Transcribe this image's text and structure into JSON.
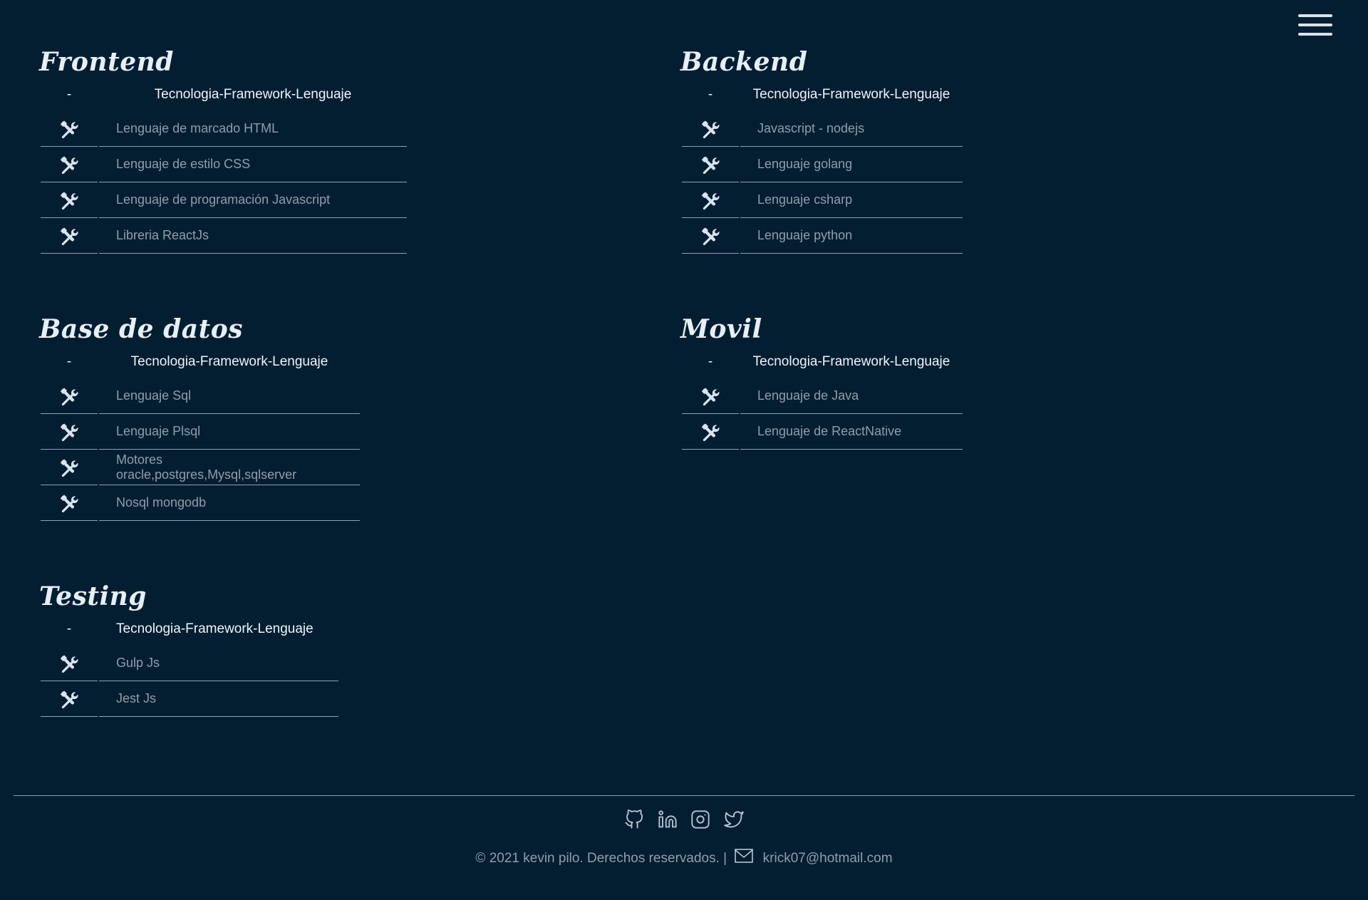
{
  "menu": {
    "icon": "hamburger-menu-icon"
  },
  "sections": {
    "frontend": {
      "title": "Frontend",
      "header_dash": "-",
      "header_label": "Tecnologia-Framework-Lenguaje",
      "items": [
        "Lenguaje de marcado HTML",
        "Lenguaje de estilo CSS",
        "Lenguaje de programación Javascript",
        "Libreria ReactJs"
      ]
    },
    "backend": {
      "title": "Backend",
      "header_dash": "-",
      "header_label": "Tecnologia-Framework-Lenguaje",
      "items": [
        "Javascript - nodejs",
        "Lenguaje golang",
        "Lenguaje csharp",
        "Lenguaje python"
      ]
    },
    "database": {
      "title": "Base de datos",
      "header_dash": "-",
      "header_label": "Tecnologia-Framework-Lenguaje",
      "items": [
        "Lenguaje Sql",
        "Lenguaje Plsql",
        "Motores oracle,postgres,Mysql,sqlserver",
        "Nosql mongodb"
      ]
    },
    "mobile": {
      "title": "Movil",
      "header_dash": "-",
      "header_label": "Tecnologia-Framework-Lenguaje",
      "items": [
        "Lenguaje de Java",
        "Lenguaje de ReactNative"
      ]
    },
    "testing": {
      "title": "Testing",
      "header_dash": "-",
      "header_label": "Tecnologia-Framework-Lenguaje",
      "items": [
        "Gulp Js",
        "Jest Js"
      ]
    }
  },
  "footer": {
    "social_icons": [
      "github-icon",
      "linkedin-icon",
      "instagram-icon",
      "twitter-icon"
    ],
    "copyright": "© 2021 kevin pilo. Derechos reservados. |",
    "email": "krick07@hotmail.com"
  },
  "colors": {
    "background": "#031e30",
    "text": "#c9d3df",
    "muted": "#8e9ead",
    "divider": "#8fa1b3"
  }
}
